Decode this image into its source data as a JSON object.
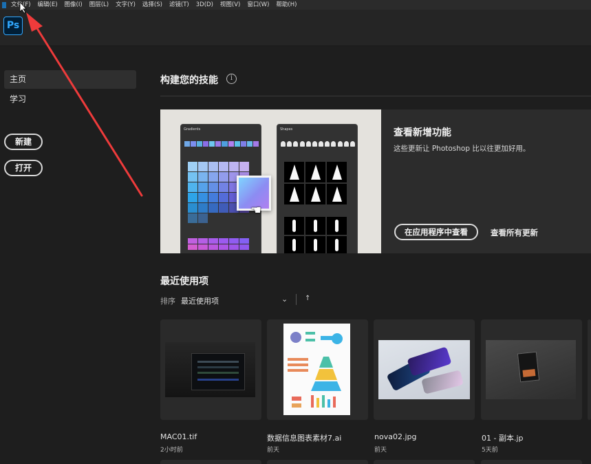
{
  "menu": {
    "items": [
      "文件(F)",
      "编辑(E)",
      "图像(I)",
      "图层(L)",
      "文字(Y)",
      "选择(S)",
      "滤镜(T)",
      "3D(D)",
      "视图(V)",
      "窗口(W)",
      "帮助(H)"
    ]
  },
  "app": {
    "logo": "Ps"
  },
  "sidebar": {
    "home": "主页",
    "learn": "学习",
    "new_button": "新建",
    "open_button": "打开"
  },
  "skills": {
    "title": "构建您的技能",
    "info_icon": "i",
    "promo": {
      "title": "查看新增功能",
      "desc": "这些更新让 Photoshop 比以往更加好用。",
      "button": "在应用程序中查看",
      "link": "查看所有更新",
      "panel_gradients": "Gradients",
      "panel_shapes": "Shapes"
    }
  },
  "recent": {
    "title": "最近使用项",
    "sort_label": "排序",
    "sort_value": "最近使用项",
    "sort_chevron": "⌄",
    "sort_arrow": "↑",
    "files": [
      {
        "name": "MAC01.tif",
        "time": "2小时前"
      },
      {
        "name": "数据信息图表素材7.ai",
        "time": "前天"
      },
      {
        "name": "nova02.jpg",
        "time": "前天"
      },
      {
        "name": "01 - 副本.jp",
        "time": "5天前"
      }
    ]
  },
  "colors": {
    "accent": "#31a8ff",
    "annotation_arrow": "#ee3b3b",
    "background": "#1e1e1e"
  }
}
